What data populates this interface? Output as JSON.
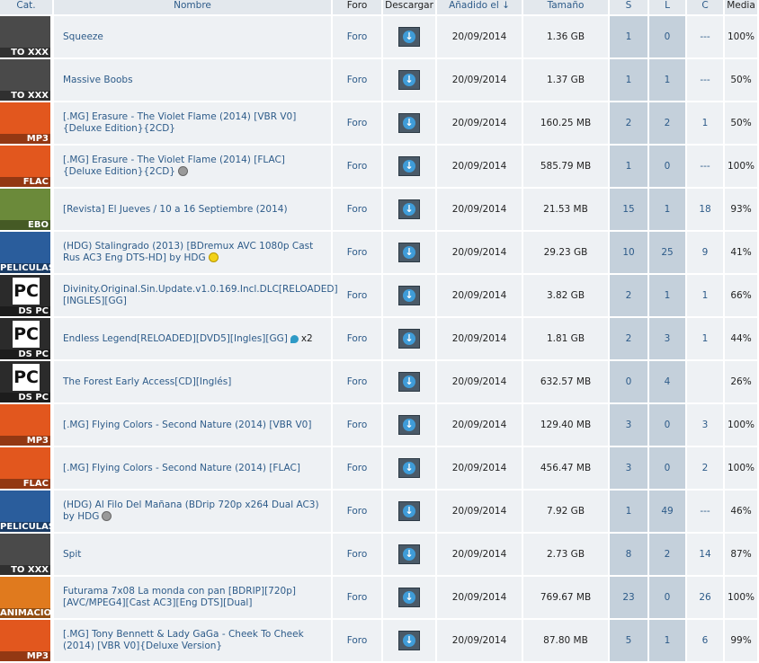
{
  "headers": {
    "cat": "Cat.",
    "nombre": "Nombre",
    "foro": "Foro",
    "descargar": "Descargar",
    "anadido": "Añadido el ↓",
    "tamano": "Tamaño",
    "s": "S",
    "l": "L",
    "c": "C",
    "media": "Media"
  },
  "rows": [
    {
      "cat": "TO XXX",
      "cat_color": "#4a4a4a",
      "name": "Squeeze",
      "foro": "Foro",
      "date": "20/09/2014",
      "size": "1.36 GB",
      "s": "1",
      "l": "0",
      "c": "---",
      "media": "100%"
    },
    {
      "cat": "TO XXX",
      "cat_color": "#4a4a4a",
      "name": "Massive Boobs",
      "foro": "Foro",
      "date": "20/09/2014",
      "size": "1.37 GB",
      "s": "1",
      "l": "1",
      "c": "---",
      "media": "50%"
    },
    {
      "cat": "MP3",
      "cat_color": "#e2571e",
      "name": "[.MG] Erasure - The Violet Flame (2014) [VBR V0]{Deluxe Edition}{2CD}",
      "foro": "Foro",
      "date": "20/09/2014",
      "size": "160.25 MB",
      "s": "2",
      "l": "2",
      "c": "1",
      "media": "50%"
    },
    {
      "cat": "FLAC",
      "cat_color": "#e2571e",
      "name": "[.MG] Erasure - The Violet Flame (2014) [FLAC]{Deluxe Edition}{2CD}",
      "badge": "silver",
      "foro": "Foro",
      "date": "20/09/2014",
      "size": "585.79 MB",
      "s": "1",
      "l": "0",
      "c": "---",
      "media": "100%"
    },
    {
      "cat": "EBO",
      "cat_color": "#6b8a3a",
      "name": "[Revista] El Jueves / 10 a 16 Septiembre (2014)",
      "foro": "Foro",
      "date": "20/09/2014",
      "size": "21.53 MB",
      "s": "15",
      "l": "1",
      "c": "18",
      "media": "93%"
    },
    {
      "cat": "PELICULAS",
      "cat_color": "#2a5d9c",
      "name": "(HDG) Stalingrado (2013) [BDremux AVC 1080p Cast Rus AC3 Eng DTS-HD] by HDG",
      "badge": "gold",
      "foro": "Foro",
      "date": "20/09/2014",
      "size": "29.23 GB",
      "s": "10",
      "l": "25",
      "c": "9",
      "media": "41%"
    },
    {
      "cat": "DS PC",
      "cat_color": "#2b2b2b",
      "pc": "PC",
      "name": "Divinity.Original.Sin.Update.v1.0.169.Incl.DLC[RELOADED][INGLES][GG]",
      "foro": "Foro",
      "date": "20/09/2014",
      "size": "3.82 GB",
      "s": "2",
      "l": "1",
      "c": "1",
      "media": "66%"
    },
    {
      "cat": "DS PC",
      "cat_color": "#2b2b2b",
      "pc": "PC",
      "name": "Endless Legend[RELOADED][DVD5][Ingles][GG]",
      "badge": "drop",
      "extra": "x2",
      "foro": "Foro",
      "date": "20/09/2014",
      "size": "1.81 GB",
      "s": "2",
      "l": "3",
      "c": "1",
      "media": "44%"
    },
    {
      "cat": "DS PC",
      "cat_color": "#2b2b2b",
      "pc": "PC",
      "name": "The Forest Early Access[CD][Inglés]",
      "foro": "Foro",
      "date": "20/09/2014",
      "size": "632.57 MB",
      "s": "0",
      "l": "4",
      "c": "",
      "media": "26%"
    },
    {
      "cat": "MP3",
      "cat_color": "#e2571e",
      "name": "[.MG] Flying Colors - Second Nature (2014) [VBR V0]",
      "foro": "Foro",
      "date": "20/09/2014",
      "size": "129.40 MB",
      "s": "3",
      "l": "0",
      "c": "3",
      "media": "100%"
    },
    {
      "cat": "FLAC",
      "cat_color": "#e2571e",
      "name": "[.MG] Flying Colors - Second Nature (2014) [FLAC]",
      "foro": "Foro",
      "date": "20/09/2014",
      "size": "456.47 MB",
      "s": "3",
      "l": "0",
      "c": "2",
      "media": "100%"
    },
    {
      "cat": "PELICULAS",
      "cat_color": "#2a5d9c",
      "name": "(HDG) Al Filo Del Mañana (BDrip 720p x264 Dual AC3) by HDG",
      "badge": "silver",
      "foro": "Foro",
      "date": "20/09/2014",
      "size": "7.92 GB",
      "s": "1",
      "l": "49",
      "c": "---",
      "media": "46%"
    },
    {
      "cat": "TO XXX",
      "cat_color": "#4a4a4a",
      "name": "Spit",
      "foro": "Foro",
      "date": "20/09/2014",
      "size": "2.73 GB",
      "s": "8",
      "l": "2",
      "c": "14",
      "media": "87%"
    },
    {
      "cat": "ANIMACIO",
      "cat_color": "#e07a1e",
      "name": "Futurama 7x08 La monda con pan [BDRIP][720p][AVC/MPEG4][Cast AC3][Eng DTS][Dual]",
      "foro": "Foro",
      "date": "20/09/2014",
      "size": "769.67 MB",
      "s": "23",
      "l": "0",
      "c": "26",
      "media": "100%"
    },
    {
      "cat": "MP3",
      "cat_color": "#e2571e",
      "name": "[.MG] Tony Bennett & Lady GaGa - Cheek To Cheek (2014) [VBR V0]{Deluxe Version}",
      "foro": "Foro",
      "date": "20/09/2014",
      "size": "87.80 MB",
      "s": "5",
      "l": "1",
      "c": "6",
      "media": "99%"
    }
  ]
}
